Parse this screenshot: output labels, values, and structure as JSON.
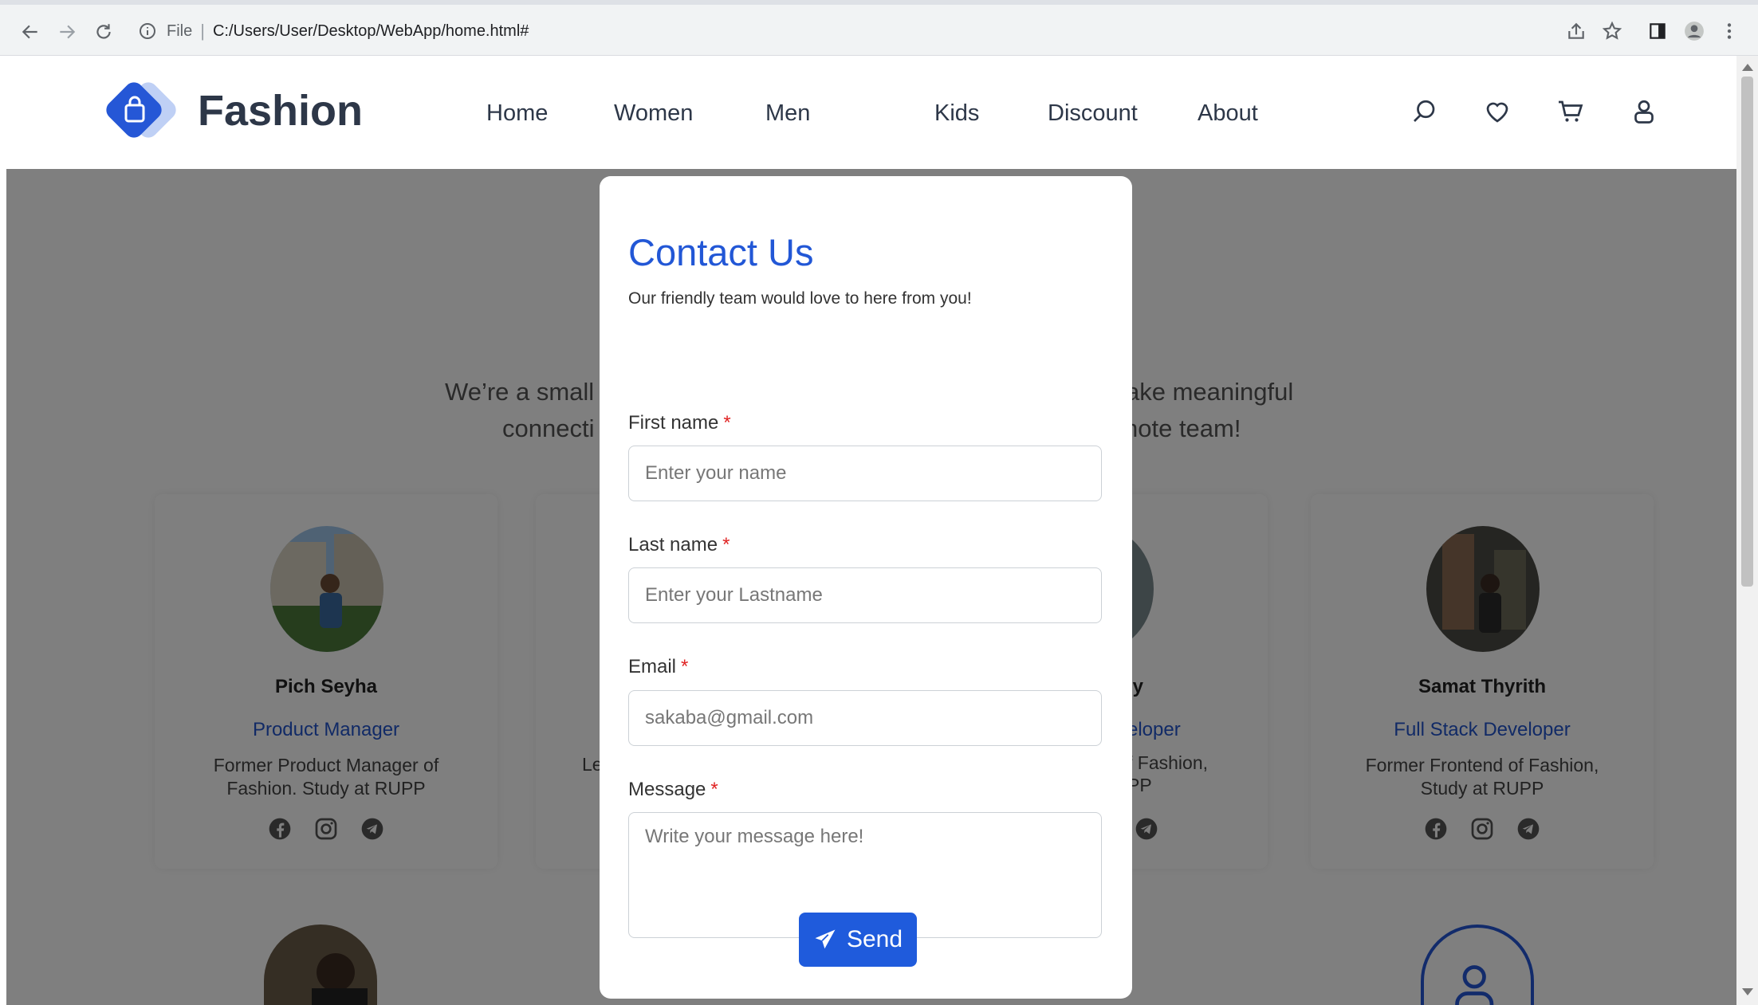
{
  "browser": {
    "file_label": "File",
    "separator": "|",
    "url": "C:/Users/User/Desktop/WebApp/home.html#"
  },
  "header": {
    "brand": "Fashion",
    "brand_color": "#2557d6",
    "menu": [
      "Home",
      "Women",
      "Men",
      "Kids",
      "Discount",
      "About"
    ],
    "icons": [
      "search-icon",
      "heart-icon",
      "cart-icon",
      "user-icon"
    ]
  },
  "about": {
    "intro_line1_left": "We’re a small t",
    "intro_line1_right": "ake meaningful",
    "intro_line2_left": "connecti",
    "intro_line2_right": "note team!"
  },
  "team": [
    {
      "name": "Pich Seyha",
      "role": "Product Manager",
      "desc": "Former Product Manager of Fashion. Study at RUPP"
    },
    {
      "desc_fragment": "Le"
    },
    {
      "name_fragment": "ly",
      "role_fragment": "eloper",
      "desc_fragment_1": "f Fashion,",
      "desc_fragment_2": "PP"
    },
    {
      "name": "Samat Thyrith",
      "role": "Full Stack Developer",
      "desc": "Former Frontend of Fashion, Study at RUPP"
    }
  ],
  "modal": {
    "title": "Contact Us",
    "subtitle": "Our friendly team would love to here from you!",
    "required_mark": "*",
    "first_name": {
      "label": "First name",
      "placeholder": "Enter your name",
      "value": ""
    },
    "last_name": {
      "label": "Last name",
      "placeholder": "Enter your Lastname",
      "value": ""
    },
    "email": {
      "label": "Email",
      "placeholder": "sakaba@gmail.com",
      "value": ""
    },
    "message": {
      "label": "Message",
      "placeholder": "Write your message here!",
      "value": ""
    },
    "send_label": "Send",
    "accent_color": "#1f5bdc"
  }
}
